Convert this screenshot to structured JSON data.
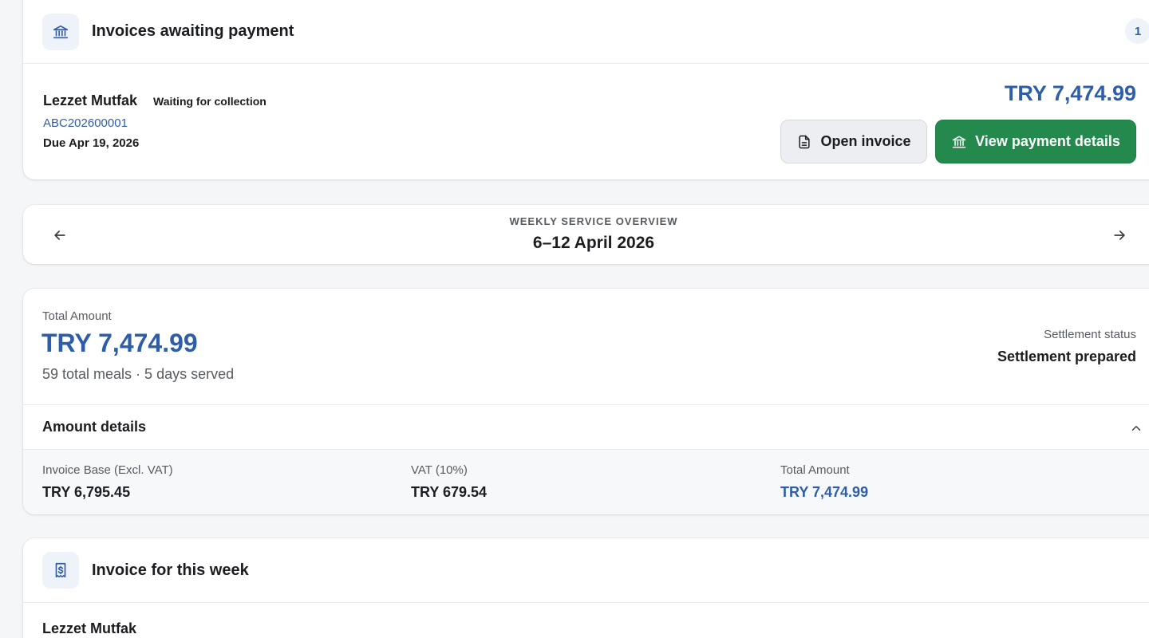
{
  "awaiting": {
    "title": "Invoices awaiting payment",
    "count": "1",
    "icon": "bank-icon",
    "invoice": {
      "vendor": "Lezzet Mutfak",
      "status": "Waiting for collection",
      "number": "ABC202600001",
      "due": "Due Apr 19, 2026",
      "amount": "TRY 7,474.99"
    },
    "open_label": "Open invoice",
    "payment_label": "View payment details"
  },
  "week": {
    "caption": "WEEKLY SERVICE OVERVIEW",
    "range": "6–12 April 2026"
  },
  "totals": {
    "label": "Total Amount",
    "amount": "TRY 7,474.99",
    "summary": "59 total meals · 5 days served",
    "settlement_label": "Settlement status",
    "settlement_value": "Settlement prepared",
    "details_title": "Amount details",
    "base_label": "Invoice Base (Excl. VAT)",
    "base_value": "TRY 6,795.45",
    "vat_label": "VAT (10%)",
    "vat_value": "TRY 679.54",
    "total_label": "Total Amount",
    "total_value": "TRY 7,474.99"
  },
  "week_invoice": {
    "title": "Invoice for this week",
    "icon": "receipt-icon",
    "vendor": "Lezzet Mutfak"
  },
  "colors": {
    "accent_blue": "#2f5ea8",
    "primary_green": "#23894c",
    "page_bg": "#f5f6f8"
  }
}
